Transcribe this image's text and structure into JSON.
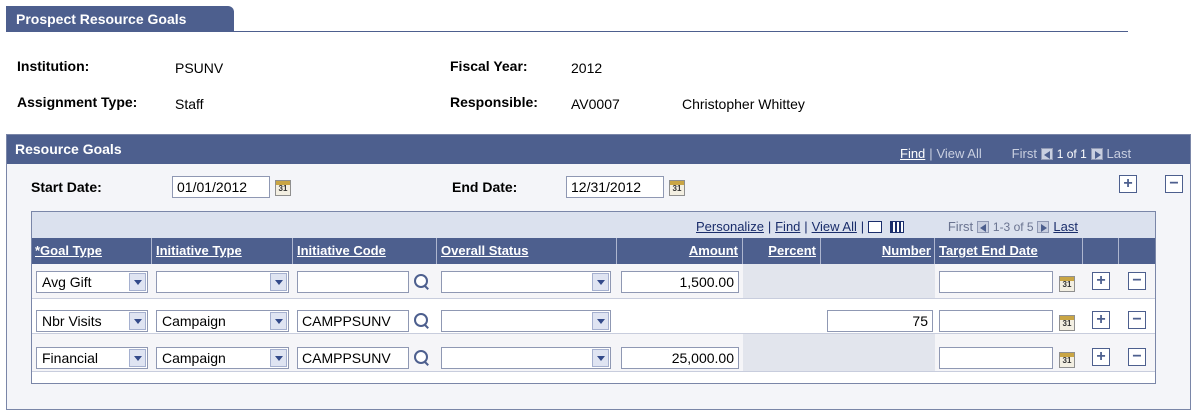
{
  "page_tab": "Prospect Resource Goals",
  "header": {
    "institution_label": "Institution:",
    "institution_value": "PSUNV",
    "fiscal_year_label": "Fiscal Year:",
    "fiscal_year_value": "2012",
    "assignment_type_label": "Assignment Type:",
    "assignment_type_value": "Staff",
    "responsible_label": "Responsible:",
    "responsible_id": "AV0007",
    "responsible_name": "Christopher Whittey"
  },
  "resource_goals": {
    "title": "Resource Goals",
    "nav": {
      "find": "Find",
      "sep": "|",
      "view_all": "View All",
      "first": "First",
      "count": "1 of 1",
      "last": "Last"
    },
    "start_date_label": "Start Date:",
    "start_date_value": "01/01/2012",
    "end_date_label": "End Date:",
    "end_date_value": "12/31/2012",
    "calendar_glyph": "31",
    "add_symbol": "+",
    "remove_symbol": "−"
  },
  "grid": {
    "nav": {
      "personalize": "Personalize",
      "find": "Find",
      "view_all": "View All",
      "sep": "|",
      "first": "First",
      "count": "1-3 of 5",
      "last": "Last"
    },
    "columns": [
      "*Goal Type",
      "Initiative Type",
      "Initiative Code",
      "Overall Status",
      "Amount",
      "Percent",
      "Number",
      "Target End Date"
    ],
    "rows": [
      {
        "goal_type": "Avg Gift",
        "initiative_type": "",
        "initiative_code": "",
        "overall_status": "",
        "amount": "1,500.00",
        "number": "",
        "target_end_date": ""
      },
      {
        "goal_type": "Nbr Visits",
        "initiative_type": "Campaign",
        "initiative_code": "CAMPPSUNV",
        "overall_status": "",
        "amount": "",
        "number": "75",
        "target_end_date": ""
      },
      {
        "goal_type": "Financial",
        "initiative_type": "Campaign",
        "initiative_code": "CAMPPSUNV",
        "overall_status": "",
        "amount": "25,000.00",
        "number": "",
        "target_end_date": ""
      }
    ]
  },
  "colors": {
    "header_blue": "#4d5f8e",
    "grid_nav_bg": "#dbe1ee",
    "link_blue": "#1a2d6b"
  }
}
